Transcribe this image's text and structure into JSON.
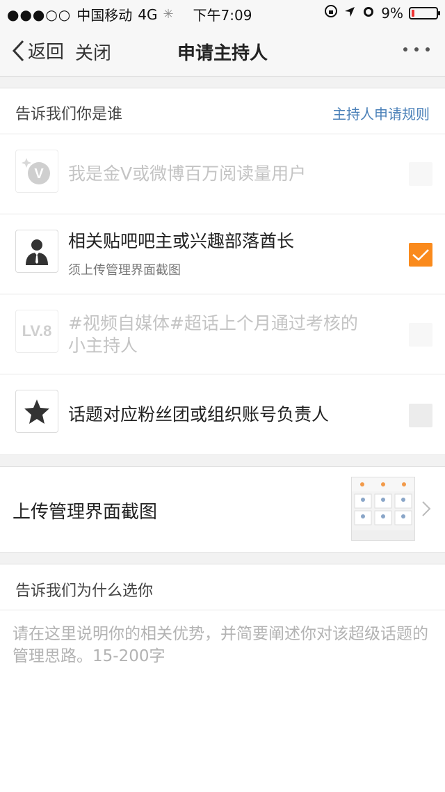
{
  "status_bar": {
    "carrier": "中国移动",
    "network": "4G",
    "time": "下午7:09",
    "battery": "9%"
  },
  "nav": {
    "back_label": "返回",
    "close_label": "关闭",
    "title": "申请主持人"
  },
  "who_section": {
    "label": "告诉我们你是谁",
    "rules_link": "主持人申请规则"
  },
  "options": [
    {
      "icon": "gold-v-badge-icon",
      "text": "我是金V或微博百万阅读量用户",
      "sub": "",
      "enabled": false,
      "checked": false
    },
    {
      "icon": "businessman-icon",
      "text": "相关贴吧吧主或兴趣部落酋长",
      "sub": "须上传管理界面截图",
      "enabled": true,
      "checked": true
    },
    {
      "icon": "level-8-badge-icon",
      "text": "#视频自媒体#超话上个月通过考核的小主持人",
      "text_line1": "#视频自媒体#超话上个月通过考核的",
      "text_line2": "小主持人",
      "sub": "",
      "enabled": false,
      "checked": false
    },
    {
      "icon": "star-icon",
      "text": "话题对应粉丝团或组织账号负责人",
      "sub": "",
      "enabled": true,
      "checked": false
    }
  ],
  "level_badge_text": "LV.8",
  "upload": {
    "label": "上传管理界面截图"
  },
  "why_section": {
    "label": "告诉我们为什么选你"
  },
  "reason_input": {
    "value": "",
    "placeholder": "请在这里说明你的相关优势，并简要阐述你对该超级话题的管理思路。15-200字"
  },
  "colors": {
    "accent": "#fa8a1c",
    "link": "#4a80b8",
    "background_gap": "#f2f2f2"
  }
}
